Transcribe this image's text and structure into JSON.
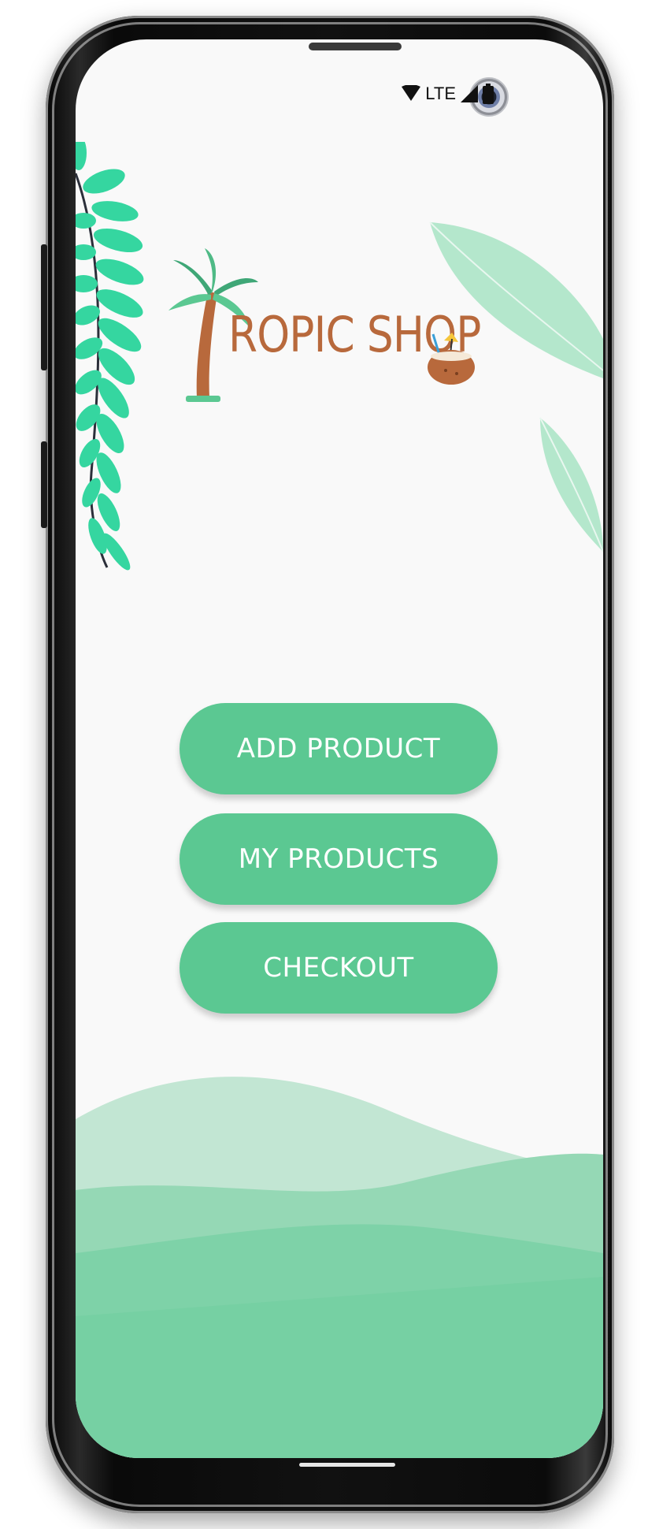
{
  "status_bar": {
    "network_label": "LTE",
    "icons": [
      "wifi-icon",
      "signal-icon",
      "battery-icon"
    ]
  },
  "logo": {
    "text": "ROPIC SHOP",
    "icon": "palm-tree-icon",
    "accent_icon": "coconut-drink-icon",
    "color": "#b8693c"
  },
  "menu": {
    "add_product_label": "ADD PRODUCT",
    "my_products_label": "MY PRODUCTS",
    "checkout_label": "CHECKOUT"
  },
  "colors": {
    "button": "#5bc892",
    "leaf": "#35d6a0",
    "wave": "#7ed2a8",
    "background": "#f9f9f9"
  }
}
